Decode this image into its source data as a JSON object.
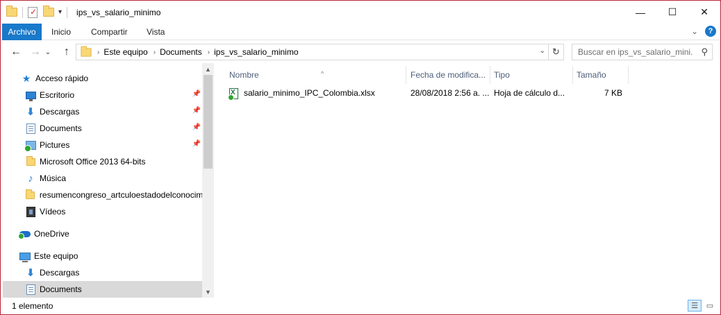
{
  "window": {
    "title": "ips_vs_salario_minimo",
    "controls": {
      "minimize": "—",
      "maximize": "☐",
      "close": "✕"
    }
  },
  "quick_access_toolbar": {
    "dropdown_glyph": "▾"
  },
  "ribbon": {
    "tabs": [
      {
        "label": "Archivo",
        "active": true
      },
      {
        "label": "Inicio"
      },
      {
        "label": "Compartir"
      },
      {
        "label": "Vista"
      }
    ],
    "expand_glyph": "⌄",
    "help_glyph": "?",
    "accent_color": "#1979ca"
  },
  "navigation": {
    "back": "←",
    "forward": "→",
    "recent_dropdown": "⌄",
    "up": "↑",
    "breadcrumb": [
      "Este equipo",
      "Documents",
      "ips_vs_salario_minimo"
    ],
    "breadcrumb_separator": "›",
    "address_dropdown": "⌄",
    "refresh": "↻",
    "search_placeholder": "Buscar en ips_vs_salario_mini...",
    "search_icon": "⚲"
  },
  "nav_pane": {
    "items": [
      {
        "label": "Acceso rápido",
        "icon": "star-icon",
        "indent": 0
      },
      {
        "label": "Escritorio",
        "icon": "desktop-icon",
        "indent": 1,
        "pinned": true
      },
      {
        "label": "Descargas",
        "icon": "downloads-icon",
        "indent": 1,
        "pinned": true
      },
      {
        "label": "Documents",
        "icon": "documents-icon",
        "indent": 1,
        "pinned": true
      },
      {
        "label": "Pictures",
        "icon": "pictures-icon",
        "indent": 1,
        "pinned": true
      },
      {
        "label": "Microsoft Office 2013 64-bits",
        "icon": "folder-icon",
        "indent": 1
      },
      {
        "label": "Música",
        "icon": "music-icon",
        "indent": 1
      },
      {
        "label": "resumencongreso_artculoestadodelconocim",
        "icon": "folder-icon",
        "indent": 1
      },
      {
        "label": "Vídeos",
        "icon": "videos-icon",
        "indent": 1
      },
      {
        "label": "OneDrive",
        "icon": "onedrive-icon",
        "indent": 0
      },
      {
        "label": "Este equipo",
        "icon": "this-pc-icon",
        "indent": 0
      },
      {
        "label": "Descargas",
        "icon": "downloads-icon",
        "indent": 1
      },
      {
        "label": "Documents",
        "icon": "documents-icon",
        "indent": 1,
        "selected": true
      }
    ],
    "pin_glyph": "📌",
    "scroll_up": "▲",
    "scroll_down": "▼"
  },
  "columns": {
    "name": "Nombre",
    "date": "Fecha de modifica...",
    "type": "Tipo",
    "size": "Tamaño",
    "sort_glyph": "^"
  },
  "files": [
    {
      "name": "salario_minimo_IPC_Colombia.xlsx",
      "date": "28/08/2018 2:56 a. ...",
      "type": "Hoja de cálculo d...",
      "size": "7 KB"
    }
  ],
  "status": {
    "count": "1 elemento",
    "details_view_glyph": "☰",
    "thumbnails_view_glyph": "▭"
  }
}
